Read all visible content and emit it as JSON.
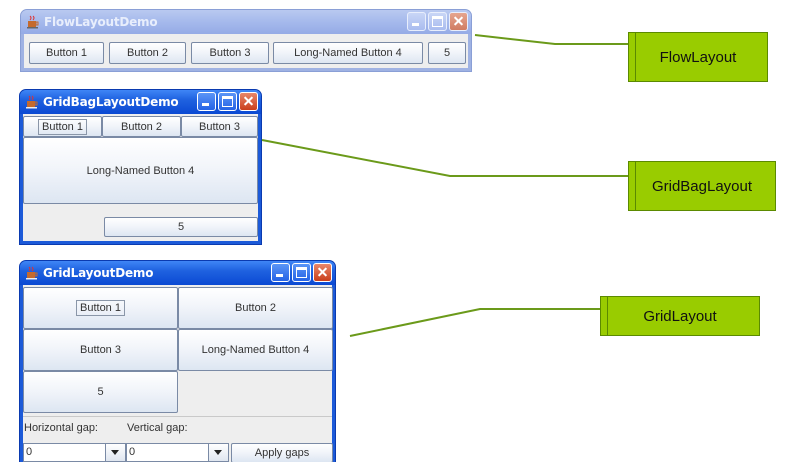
{
  "flow_window": {
    "title": "FlowLayoutDemo",
    "buttons": [
      "Button 1",
      "Button 2",
      "Button 3",
      "Long-Named Button 4",
      "5"
    ]
  },
  "gridbag_window": {
    "title": "GridBagLayoutDemo",
    "buttons": [
      "Button 1",
      "Button 2",
      "Button 3",
      "Long-Named Button 4",
      "5"
    ]
  },
  "grid_window": {
    "title": "GridLayoutDemo",
    "buttons": [
      "Button 1",
      "Button 2",
      "Button 3",
      "Long-Named Button 4",
      "5"
    ],
    "horizontal_gap_label": "Horizontal gap:",
    "vertical_gap_label": "Vertical gap:",
    "horizontal_gap_value": "0",
    "vertical_gap_value": "0",
    "apply_label": "Apply gaps"
  },
  "callouts": {
    "flow": "FlowLayout",
    "gridbag": "GridBagLayout",
    "grid": "GridLayout"
  },
  "colors": {
    "callout_fill": "#99cc00",
    "connector_line": "#6b9a1a",
    "active_titlebar": "#1f62e0",
    "inactive_titlebar": "#a5b9ec"
  }
}
